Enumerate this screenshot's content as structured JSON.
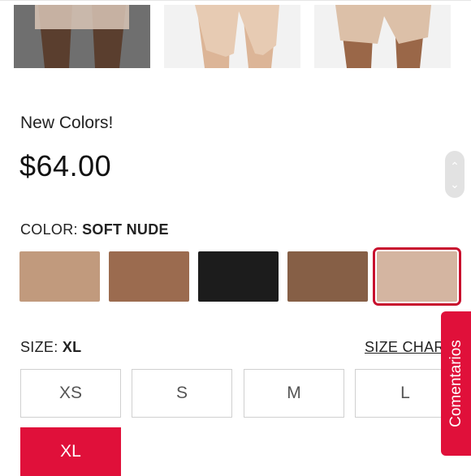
{
  "product": {
    "tagline": "New Colors!",
    "price": "$64.00"
  },
  "color": {
    "label": "COLOR:",
    "selected": "SOFT NUDE",
    "swatches": [
      {
        "hex": "#c19a7d"
      },
      {
        "hex": "#9b6b4f"
      },
      {
        "hex": "#1c1c1c"
      },
      {
        "hex": "#865f46"
      },
      {
        "hex": "#d4b5a1"
      }
    ]
  },
  "size": {
    "label": "SIZE:",
    "selected": "XL",
    "chart_link": "SIZE CHART",
    "options": [
      "XS",
      "S",
      "M",
      "L",
      "XL"
    ]
  },
  "feedback_tab": {
    "label": "Comentarios"
  },
  "colors": {
    "accent": "#e0103a",
    "selected_outline": "#c8102e"
  },
  "thumbnails": [
    {
      "name": "thumbnail-dark-background"
    },
    {
      "name": "thumbnail-light-background"
    },
    {
      "name": "thumbnail-light-background-2"
    }
  ]
}
